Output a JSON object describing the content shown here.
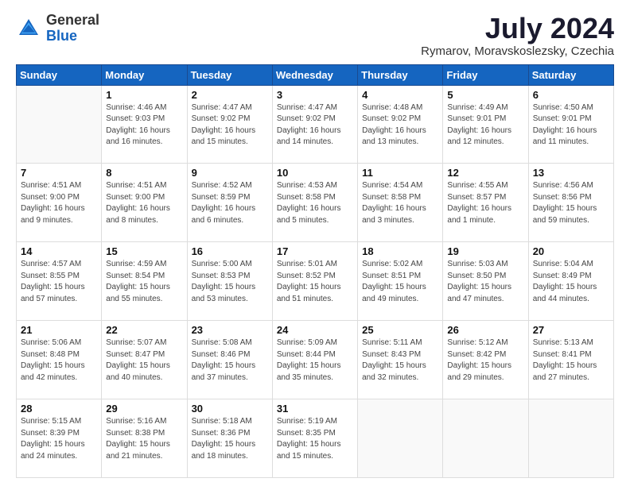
{
  "logo": {
    "general": "General",
    "blue": "Blue"
  },
  "header": {
    "title": "July 2024",
    "location": "Rymarov, Moravskoslezsky, Czechia"
  },
  "weekdays": [
    "Sunday",
    "Monday",
    "Tuesday",
    "Wednesday",
    "Thursday",
    "Friday",
    "Saturday"
  ],
  "weeks": [
    [
      {
        "day": "",
        "info": ""
      },
      {
        "day": "1",
        "info": "Sunrise: 4:46 AM\nSunset: 9:03 PM\nDaylight: 16 hours\nand 16 minutes."
      },
      {
        "day": "2",
        "info": "Sunrise: 4:47 AM\nSunset: 9:02 PM\nDaylight: 16 hours\nand 15 minutes."
      },
      {
        "day": "3",
        "info": "Sunrise: 4:47 AM\nSunset: 9:02 PM\nDaylight: 16 hours\nand 14 minutes."
      },
      {
        "day": "4",
        "info": "Sunrise: 4:48 AM\nSunset: 9:02 PM\nDaylight: 16 hours\nand 13 minutes."
      },
      {
        "day": "5",
        "info": "Sunrise: 4:49 AM\nSunset: 9:01 PM\nDaylight: 16 hours\nand 12 minutes."
      },
      {
        "day": "6",
        "info": "Sunrise: 4:50 AM\nSunset: 9:01 PM\nDaylight: 16 hours\nand 11 minutes."
      }
    ],
    [
      {
        "day": "7",
        "info": "Sunrise: 4:51 AM\nSunset: 9:00 PM\nDaylight: 16 hours\nand 9 minutes."
      },
      {
        "day": "8",
        "info": "Sunrise: 4:51 AM\nSunset: 9:00 PM\nDaylight: 16 hours\nand 8 minutes."
      },
      {
        "day": "9",
        "info": "Sunrise: 4:52 AM\nSunset: 8:59 PM\nDaylight: 16 hours\nand 6 minutes."
      },
      {
        "day": "10",
        "info": "Sunrise: 4:53 AM\nSunset: 8:58 PM\nDaylight: 16 hours\nand 5 minutes."
      },
      {
        "day": "11",
        "info": "Sunrise: 4:54 AM\nSunset: 8:58 PM\nDaylight: 16 hours\nand 3 minutes."
      },
      {
        "day": "12",
        "info": "Sunrise: 4:55 AM\nSunset: 8:57 PM\nDaylight: 16 hours\nand 1 minute."
      },
      {
        "day": "13",
        "info": "Sunrise: 4:56 AM\nSunset: 8:56 PM\nDaylight: 15 hours\nand 59 minutes."
      }
    ],
    [
      {
        "day": "14",
        "info": "Sunrise: 4:57 AM\nSunset: 8:55 PM\nDaylight: 15 hours\nand 57 minutes."
      },
      {
        "day": "15",
        "info": "Sunrise: 4:59 AM\nSunset: 8:54 PM\nDaylight: 15 hours\nand 55 minutes."
      },
      {
        "day": "16",
        "info": "Sunrise: 5:00 AM\nSunset: 8:53 PM\nDaylight: 15 hours\nand 53 minutes."
      },
      {
        "day": "17",
        "info": "Sunrise: 5:01 AM\nSunset: 8:52 PM\nDaylight: 15 hours\nand 51 minutes."
      },
      {
        "day": "18",
        "info": "Sunrise: 5:02 AM\nSunset: 8:51 PM\nDaylight: 15 hours\nand 49 minutes."
      },
      {
        "day": "19",
        "info": "Sunrise: 5:03 AM\nSunset: 8:50 PM\nDaylight: 15 hours\nand 47 minutes."
      },
      {
        "day": "20",
        "info": "Sunrise: 5:04 AM\nSunset: 8:49 PM\nDaylight: 15 hours\nand 44 minutes."
      }
    ],
    [
      {
        "day": "21",
        "info": "Sunrise: 5:06 AM\nSunset: 8:48 PM\nDaylight: 15 hours\nand 42 minutes."
      },
      {
        "day": "22",
        "info": "Sunrise: 5:07 AM\nSunset: 8:47 PM\nDaylight: 15 hours\nand 40 minutes."
      },
      {
        "day": "23",
        "info": "Sunrise: 5:08 AM\nSunset: 8:46 PM\nDaylight: 15 hours\nand 37 minutes."
      },
      {
        "day": "24",
        "info": "Sunrise: 5:09 AM\nSunset: 8:44 PM\nDaylight: 15 hours\nand 35 minutes."
      },
      {
        "day": "25",
        "info": "Sunrise: 5:11 AM\nSunset: 8:43 PM\nDaylight: 15 hours\nand 32 minutes."
      },
      {
        "day": "26",
        "info": "Sunrise: 5:12 AM\nSunset: 8:42 PM\nDaylight: 15 hours\nand 29 minutes."
      },
      {
        "day": "27",
        "info": "Sunrise: 5:13 AM\nSunset: 8:41 PM\nDaylight: 15 hours\nand 27 minutes."
      }
    ],
    [
      {
        "day": "28",
        "info": "Sunrise: 5:15 AM\nSunset: 8:39 PM\nDaylight: 15 hours\nand 24 minutes."
      },
      {
        "day": "29",
        "info": "Sunrise: 5:16 AM\nSunset: 8:38 PM\nDaylight: 15 hours\nand 21 minutes."
      },
      {
        "day": "30",
        "info": "Sunrise: 5:18 AM\nSunset: 8:36 PM\nDaylight: 15 hours\nand 18 minutes."
      },
      {
        "day": "31",
        "info": "Sunrise: 5:19 AM\nSunset: 8:35 PM\nDaylight: 15 hours\nand 15 minutes."
      },
      {
        "day": "",
        "info": ""
      },
      {
        "day": "",
        "info": ""
      },
      {
        "day": "",
        "info": ""
      }
    ]
  ]
}
